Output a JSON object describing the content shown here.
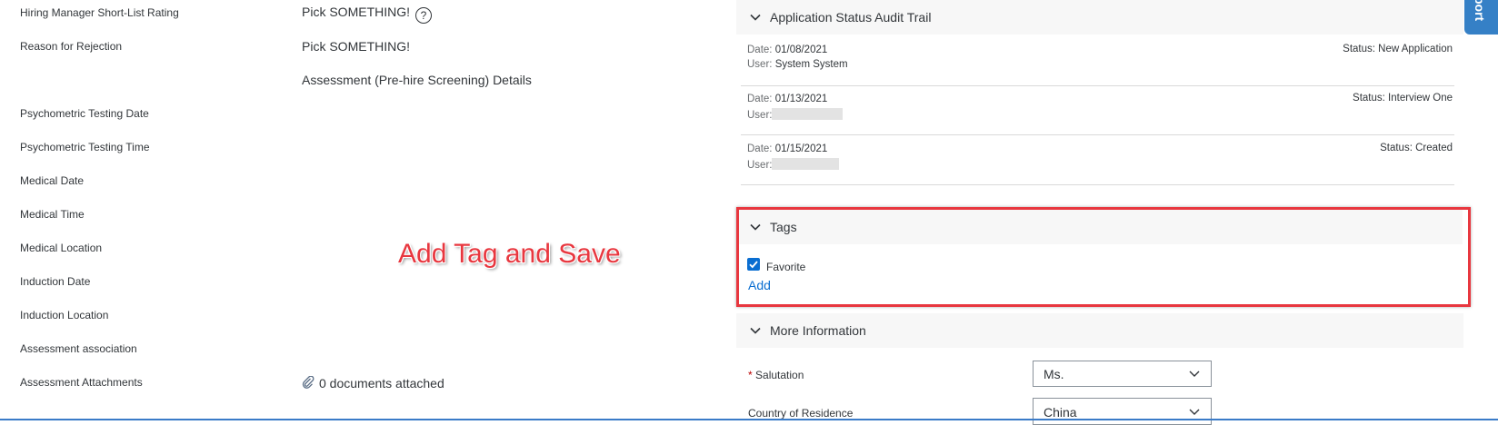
{
  "form": {
    "fields": [
      {
        "label": "Hiring Manager Short-List Rating",
        "value": "Pick SOMETHING!"
      },
      {
        "label": "Reason for Rejection",
        "value": "Pick SOMETHING!"
      },
      {
        "label": "Psychometric Testing Date",
        "value": ""
      },
      {
        "label": "Psychometric Testing Time",
        "value": ""
      },
      {
        "label": "Medical Date",
        "value": ""
      },
      {
        "label": "Medical Time",
        "value": ""
      },
      {
        "label": "Medical Location",
        "value": ""
      },
      {
        "label": "Induction Date",
        "value": ""
      },
      {
        "label": "Induction Location",
        "value": ""
      },
      {
        "label": "Assessment association",
        "value": ""
      },
      {
        "label": "Assessment Attachments",
        "value": "0 documents attached"
      }
    ],
    "help_glyph": "?",
    "assessment_heading": "Assessment (Pre-hire Screening) Details"
  },
  "annotation": "Add Tag and Save",
  "audit_trail": {
    "title": "Application Status Audit Trail",
    "date_label": "Date:",
    "user_label": "User:",
    "rows": [
      {
        "date": "01/08/2021",
        "user": "System System",
        "status": "Status: New Application"
      },
      {
        "date": "01/13/2021",
        "user": "",
        "status": "Status: Interview One"
      },
      {
        "date": "01/15/2021",
        "user": "",
        "status": "Status: Created"
      }
    ]
  },
  "tags": {
    "title": "Tags",
    "checkbox_label": "Favorite",
    "checked": true,
    "add_link": "Add"
  },
  "more_info": {
    "title": "More Information",
    "required_mark": "*",
    "fields": [
      {
        "label": "Salutation",
        "value": "Ms.",
        "required": true
      },
      {
        "label": "Country of Residence",
        "value": "China",
        "required": false
      }
    ]
  },
  "side_tab": {
    "label": "port"
  },
  "colors": {
    "accent": "#0a6ed1",
    "annotation_red": "#e8373f",
    "section_bg": "#f7f7f7",
    "side_tab": "#3580c6"
  },
  "icons": [
    "help-icon",
    "chevron-down-icon",
    "paperclip-icon",
    "checkmark-icon"
  ]
}
